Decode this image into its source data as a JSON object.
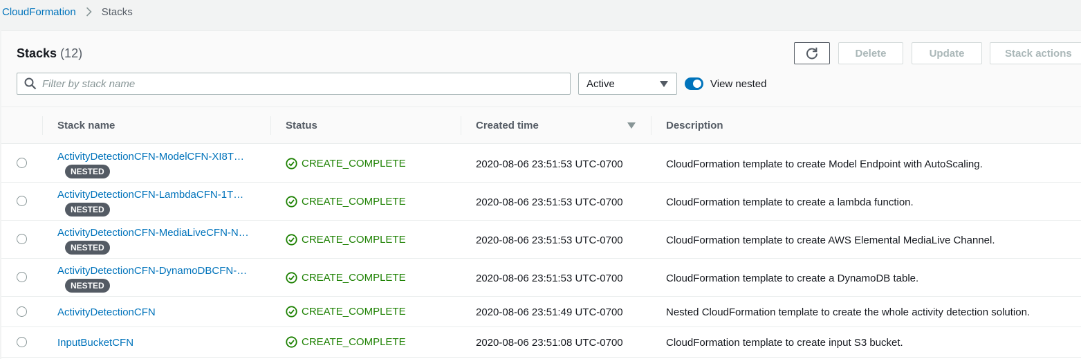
{
  "breadcrumb": {
    "root": "CloudFormation",
    "current": "Stacks"
  },
  "header": {
    "title": "Stacks",
    "count": "(12)"
  },
  "toolbar": {
    "delete_label": "Delete",
    "update_label": "Update",
    "actions_label": "Stack actions"
  },
  "filter": {
    "placeholder": "Filter by stack name",
    "status_value": "Active",
    "view_nested_label": "View nested",
    "view_nested_on": true
  },
  "table": {
    "columns": {
      "name": "Stack name",
      "status": "Status",
      "created": "Created time",
      "description": "Description"
    },
    "nested_badge": "NESTED",
    "rows": [
      {
        "name": "ActivityDetectionCFN-ModelCFN-XI8T…",
        "nested": true,
        "status": "CREATE_COMPLETE",
        "created": "2020-08-06 23:51:53 UTC-0700",
        "description": "CloudFormation template to create Model Endpoint with AutoScaling."
      },
      {
        "name": "ActivityDetectionCFN-LambdaCFN-1T…",
        "nested": true,
        "status": "CREATE_COMPLETE",
        "created": "2020-08-06 23:51:53 UTC-0700",
        "description": "CloudFormation template to create a lambda function."
      },
      {
        "name": "ActivityDetectionCFN-MediaLiveCFN-N…",
        "nested": true,
        "status": "CREATE_COMPLETE",
        "created": "2020-08-06 23:51:53 UTC-0700",
        "description": "CloudFormation template to create AWS Elemental MediaLive Channel."
      },
      {
        "name": "ActivityDetectionCFN-DynamoDBCFN-…",
        "nested": true,
        "status": "CREATE_COMPLETE",
        "created": "2020-08-06 23:51:53 UTC-0700",
        "description": "CloudFormation template to create a DynamoDB table."
      },
      {
        "name": "ActivityDetectionCFN",
        "nested": false,
        "status": "CREATE_COMPLETE",
        "created": "2020-08-06 23:51:49 UTC-0700",
        "description": "Nested CloudFormation template to create the whole activity detection solution."
      },
      {
        "name": "InputBucketCFN",
        "nested": false,
        "status": "CREATE_COMPLETE",
        "created": "2020-08-06 23:51:08 UTC-0700",
        "description": "CloudFormation template to create input S3 bucket."
      }
    ]
  },
  "colors": {
    "link": "#0073bb",
    "success": "#1d8102",
    "badge": "#545b64"
  }
}
